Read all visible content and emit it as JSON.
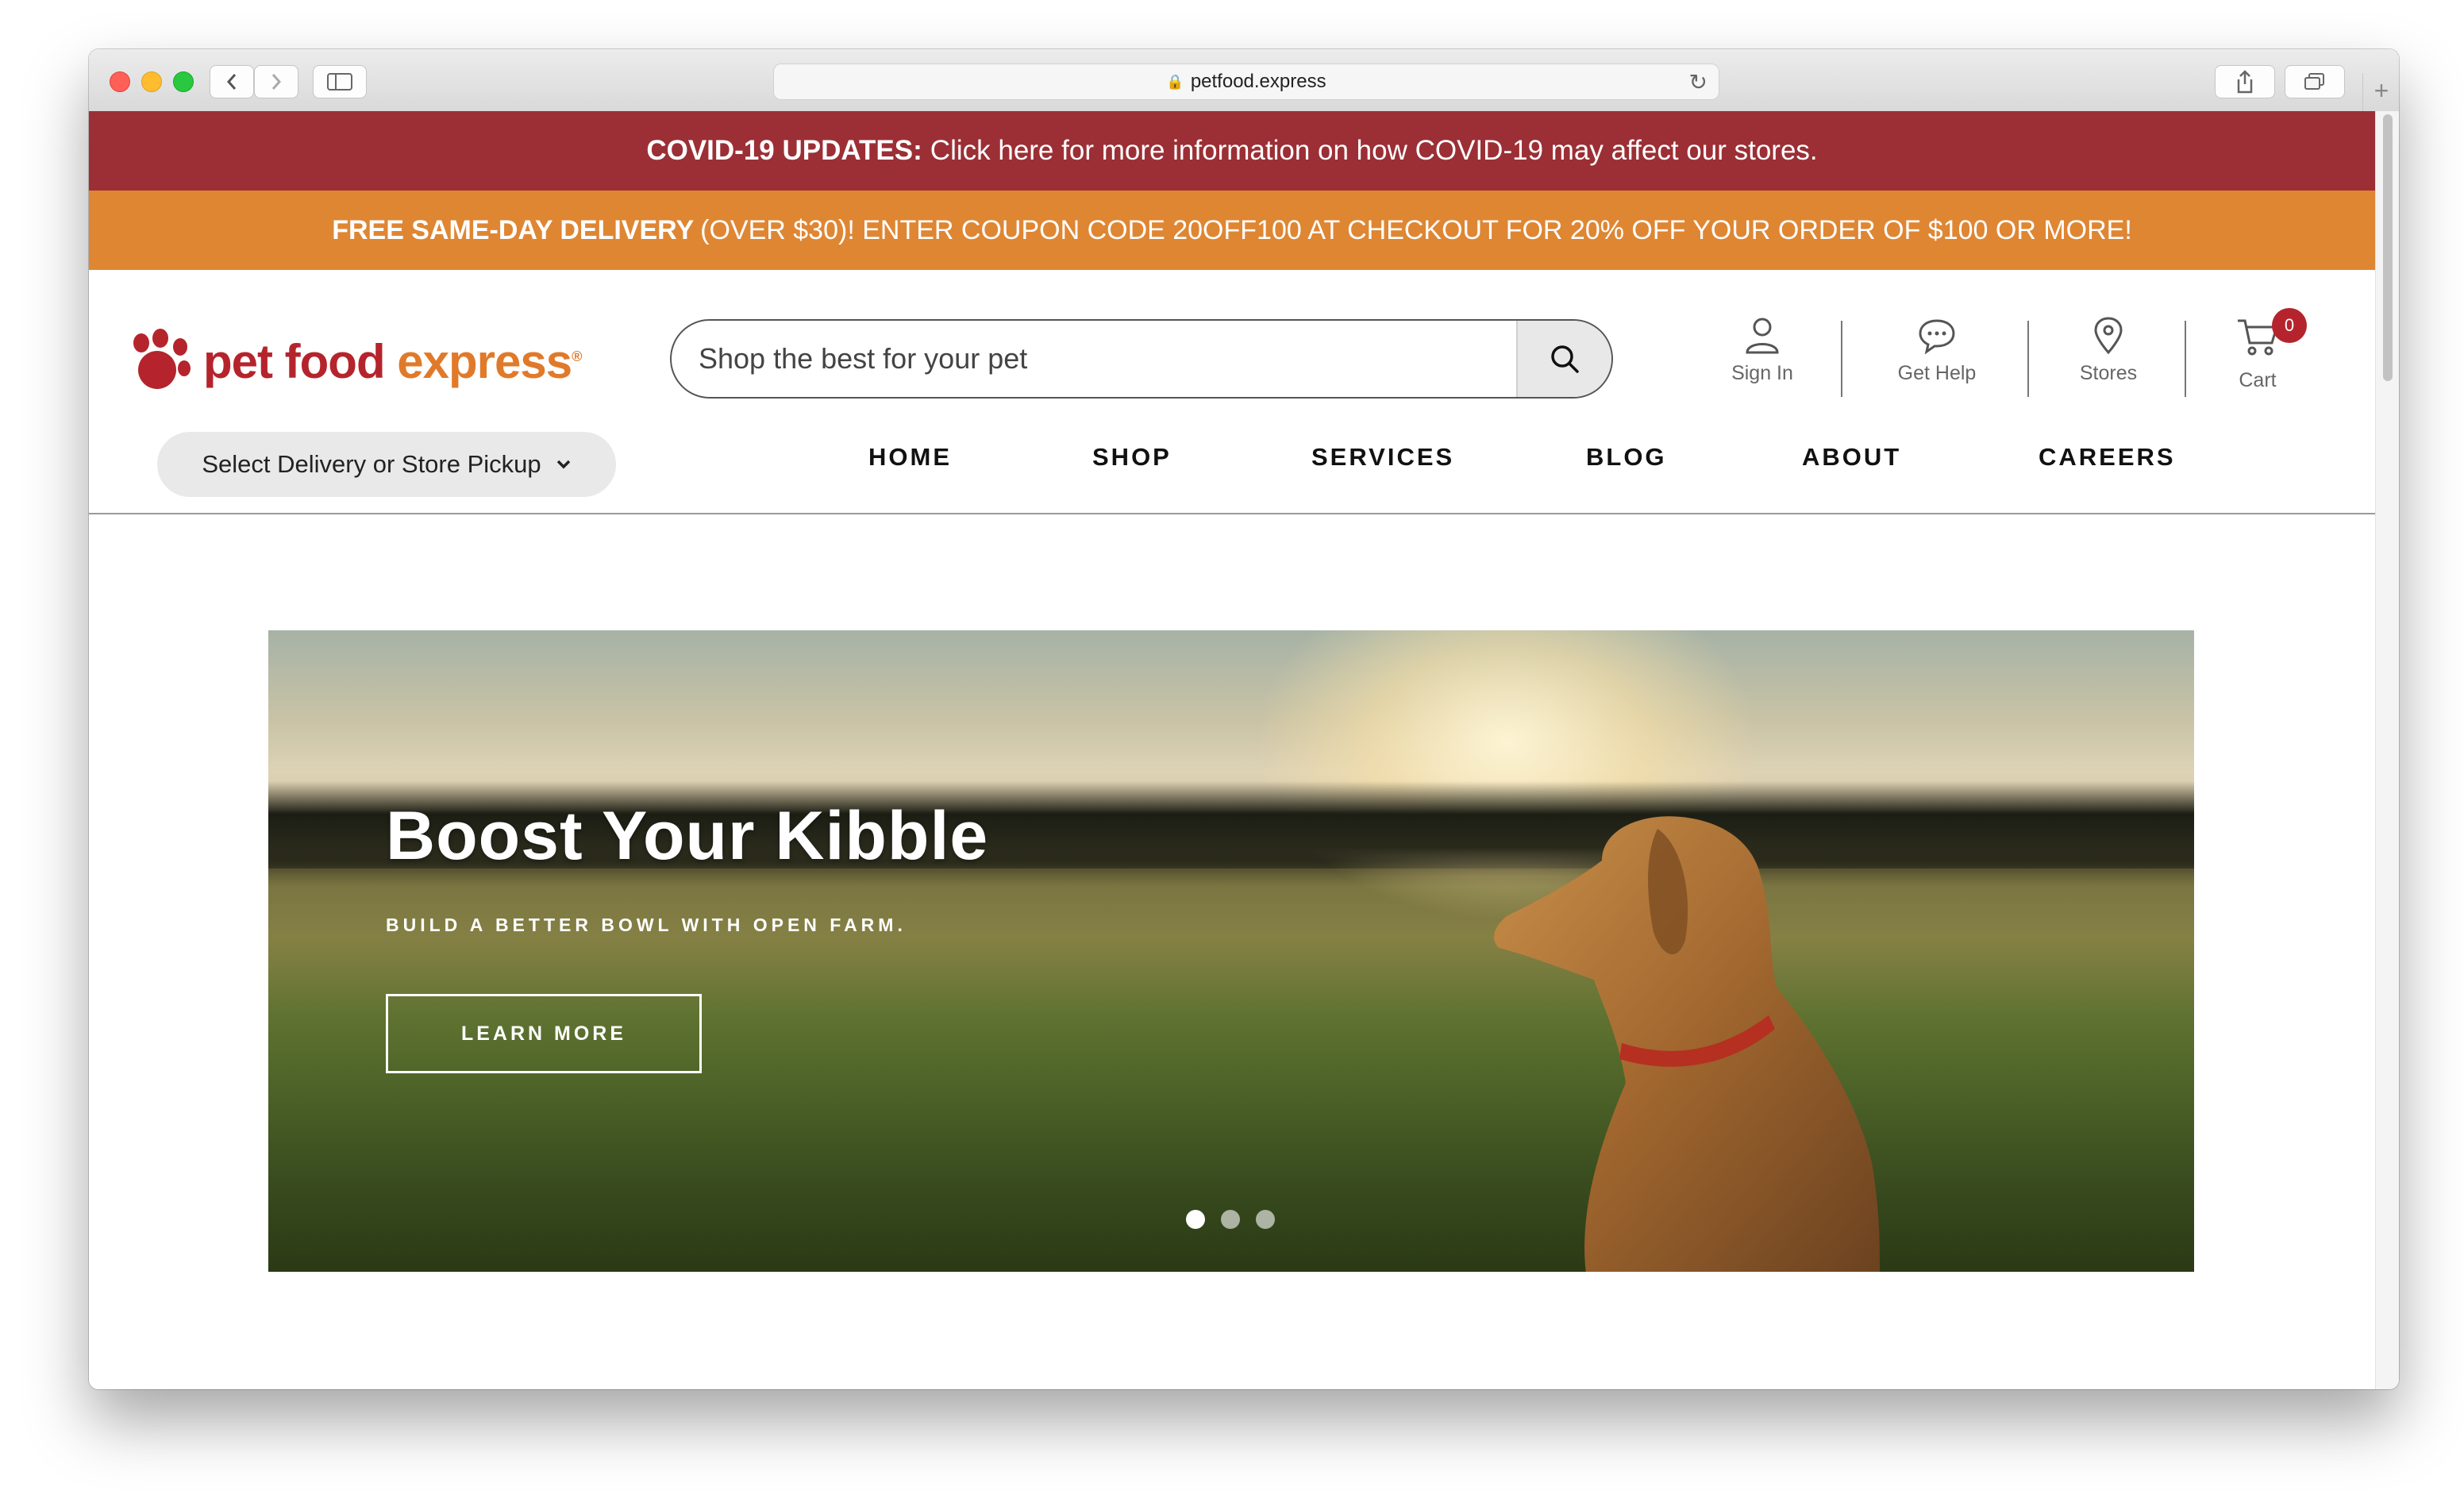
{
  "browser": {
    "url": "petfood.express"
  },
  "banners": {
    "covid_bold": "COVID-19 UPDATES:",
    "covid_text": "Click here for more information on how COVID-19 may affect our stores.",
    "promo_bold": "FREE SAME-DAY DELIVERY",
    "promo_text": "(OVER $30)! ENTER COUPON CODE 20OFF100 AT CHECKOUT FOR 20% OFF YOUR ORDER OF $100 OR MORE!"
  },
  "logo": {
    "part1": "pet food",
    "part2": "express",
    "mark": "®"
  },
  "search": {
    "placeholder": "Shop the best for your pet"
  },
  "utility": {
    "sign_in": "Sign In",
    "get_help": "Get Help",
    "stores": "Stores",
    "cart": "Cart",
    "cart_count": "0"
  },
  "delivery_selector": {
    "label": "Select Delivery or Store Pickup"
  },
  "nav": {
    "items": [
      "HOME",
      "SHOP",
      "SERVICES",
      "BLOG",
      "ABOUT",
      "CAREERS"
    ]
  },
  "hero": {
    "title": "Boost Your Kibble",
    "subtitle": "BUILD A BETTER BOWL WITH OPEN FARM.",
    "button": "LEARN MORE",
    "slide_count": 3,
    "active_slide": 1
  },
  "colors": {
    "covid_bg": "#9b2f35",
    "promo_bg": "#df8633",
    "brand_red": "#b5242c",
    "brand_orange": "#e07a2a",
    "tile_blue": "#2e6478"
  }
}
